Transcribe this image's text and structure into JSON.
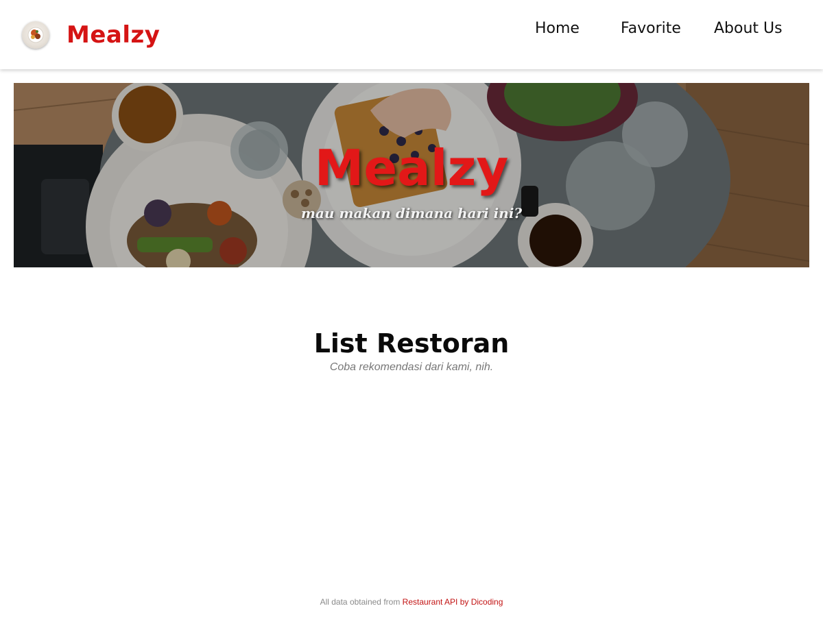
{
  "header": {
    "logo_icon": "food-plate-icon",
    "brand": "Mealzy",
    "brand_color": "#d51414",
    "nav": {
      "home": "Home",
      "favorite": "Favorite",
      "about": "About Us"
    }
  },
  "hero": {
    "title": "Mealzy",
    "tagline": "mau makan dimana hari ini?",
    "title_color": "#e21818"
  },
  "main": {
    "title": "List Restoran",
    "subtitle": "Coba rekomendasi dari kami, nih."
  },
  "footer": {
    "prefix": "All data obtained from",
    "link_label": "Restaurant API by Dicoding",
    "link_color": "#c21212"
  }
}
